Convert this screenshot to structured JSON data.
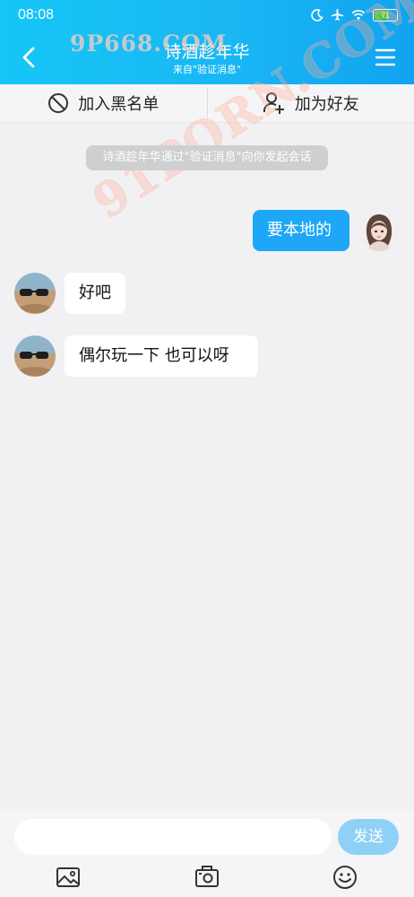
{
  "status_bar": {
    "time": "08:08",
    "battery": "71",
    "battery_level": 0.71,
    "icons": [
      "moon-icon",
      "airplane-icon",
      "wifi-icon",
      "battery-icon"
    ]
  },
  "header": {
    "title": "诗酒趁年华",
    "subtitle": "来自\"验证消息\"",
    "back_icon": "chevron-left-icon",
    "menu_icon": "hamburger-menu-icon"
  },
  "watermark": {
    "top": "9P668.COM",
    "diagonal": "91PORN.COM"
  },
  "actions": {
    "blacklist_label": "加入黑名单",
    "add_friend_label": "加为好友"
  },
  "notice": "诗酒趁年华通过\"验证消息\"向你发起会话",
  "messages": [
    {
      "direction": "outgoing",
      "text": "要本地的"
    },
    {
      "direction": "incoming",
      "text": "好吧"
    },
    {
      "direction": "incoming",
      "text": "偶尔玩一下  也可以呀"
    }
  ],
  "composer": {
    "placeholder": "",
    "value": "",
    "send_label": "发送",
    "tools": [
      "image-icon",
      "camera-icon",
      "emoji-icon"
    ]
  },
  "colors": {
    "header_gradient_start": "#16c6f6",
    "header_gradient_end": "#12a3f0",
    "outgoing_bubble": "#1ea7f6",
    "send_button": "#8fd1f6",
    "background": "#f1f1f3"
  }
}
